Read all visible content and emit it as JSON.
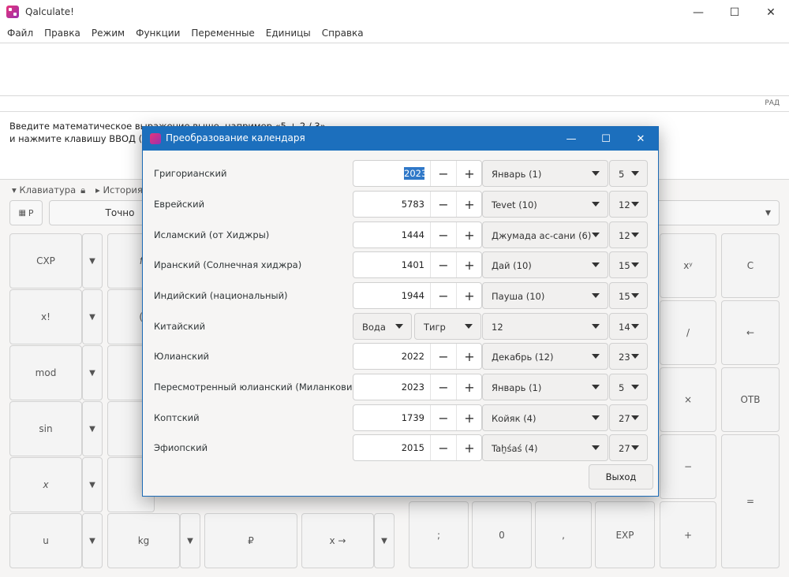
{
  "window": {
    "title": "Qalculate!",
    "controls": [
      "—",
      "☐",
      "✕"
    ]
  },
  "menu": [
    "Файл",
    "Правка",
    "Режим",
    "Функции",
    "Переменные",
    "Единицы",
    "Справка"
  ],
  "status": {
    "angle_mode": "РАД"
  },
  "result": {
    "hint_line1": "Введите математическое выражение выше, например «5 + 2 / 3»,",
    "hint_line2": "и нажмите клавишу ВВОД (Enter)."
  },
  "panels": {
    "keyboard": "Клавиатура",
    "history": "История"
  },
  "toolbar": {
    "p_button": "P",
    "exact": "Точно"
  },
  "keypad": {
    "left_col1": [
      "СХР",
      "x!",
      "mod",
      "sin",
      "x",
      "u"
    ],
    "left_col2_partial": [
      "f",
      "(",
      "",
      "",
      "",
      "kg"
    ],
    "bottom_row": [
      "₽",
      "x →",
      ";",
      "0",
      ",",
      "EXP",
      "+"
    ],
    "right_col_a": [
      "xʸ",
      "/",
      "×",
      "−"
    ],
    "right_col_b": [
      "C",
      "←",
      "ОТВ",
      "="
    ]
  },
  "dialog": {
    "title": "Преобразование календаря",
    "controls": [
      "—",
      "☐",
      "✕"
    ],
    "exit_label": "Выход",
    "rows": [
      {
        "name": "Григорианский",
        "year": "2023",
        "month": "Январь (1)",
        "day": "5",
        "year_selected": true
      },
      {
        "name": "Еврейский",
        "year": "5783",
        "month": "Tevet (10)",
        "day": "12"
      },
      {
        "name": "Исламский (от Хиджры)",
        "year": "1444",
        "month": "Джумада ас-сани (6)",
        "day": "12"
      },
      {
        "name": "Иранский (Солнечная хиджра)",
        "year": "1401",
        "month": "Дай (10)",
        "day": "15"
      },
      {
        "name": "Индийский (национальный)",
        "year": "1944",
        "month": "Пауша (10)",
        "day": "15"
      },
      {
        "name": "Китайский",
        "element": "Вода",
        "animal": "Тигр",
        "month": "12",
        "day": "14",
        "chinese": true
      },
      {
        "name": "Юлианский",
        "year": "2022",
        "month": "Декабрь (12)",
        "day": "23"
      },
      {
        "name": "Пересмотренный юлианский (Миланковича)",
        "year": "2023",
        "month": "Январь (1)",
        "day": "5"
      },
      {
        "name": "Коптский",
        "year": "1739",
        "month": "Койяк (4)",
        "day": "27"
      },
      {
        "name": "Эфиопский",
        "year": "2015",
        "month": "Taḫśaś (4)",
        "day": "27"
      }
    ]
  }
}
